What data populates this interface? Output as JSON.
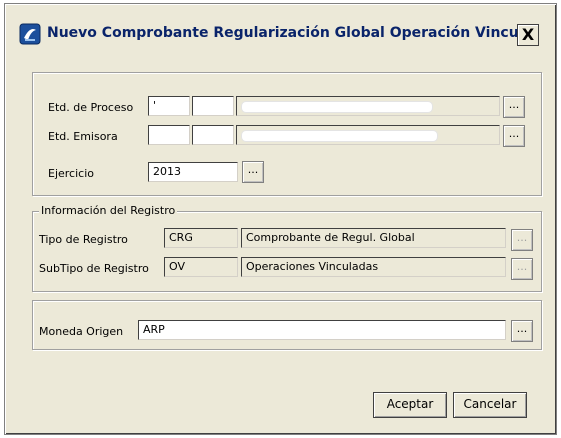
{
  "window": {
    "title": "Nuevo Comprobante Regularización Global Operación Vincul...",
    "close_label": "X"
  },
  "proceso": {
    "etd_proceso_label": "Etd. de Proceso",
    "etd_proceso_code1": "'",
    "etd_proceso_code2": "",
    "etd_emisora_label": "Etd. Emisora",
    "etd_emisora_code1": "",
    "etd_emisora_code2": "",
    "ejercicio_label": "Ejercicio",
    "ejercicio_value": "2013",
    "lookup_label": "..."
  },
  "registro": {
    "legend": "Información del Registro",
    "tipo_label": "Tipo de Registro",
    "tipo_code": "CRG",
    "tipo_desc": "Comprobante de Regul. Global",
    "subtipo_label": "SubTipo de Registro",
    "subtipo_code": "OV",
    "subtipo_desc": "Operaciones Vinculadas",
    "lookup_label": "..."
  },
  "moneda": {
    "label": "Moneda Origen",
    "value": "ARP",
    "lookup_label": "..."
  },
  "footer": {
    "accept_label": "Aceptar",
    "cancel_label": "Cancelar"
  }
}
